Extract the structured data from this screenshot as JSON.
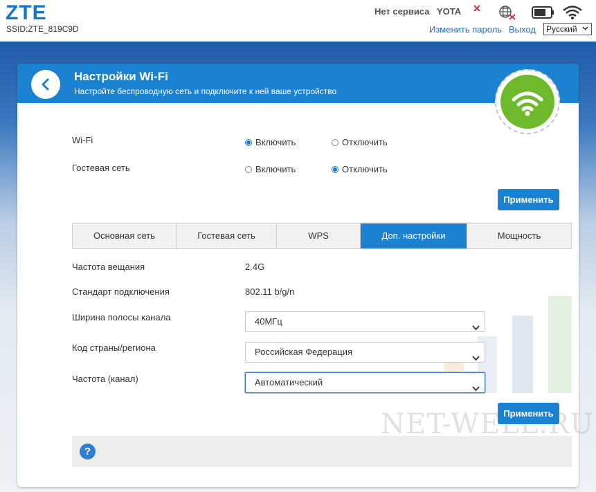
{
  "header": {
    "logo": "ZTE",
    "ssid": "SSID:ZTE_819C9D",
    "service_status": "Нет сервиса",
    "operator": "YOTA",
    "change_password": "Изменить пароль",
    "logout": "Выход",
    "language": "Русский",
    "icons": [
      "close-icon",
      "globe-disconnected-icon",
      "battery-icon",
      "wifi-signal-icon"
    ]
  },
  "panel": {
    "title": "Настройки Wi-Fi",
    "subtitle": "Настройте беспроводную сеть и подключите к ней ваше устройство",
    "wifi_row": {
      "label": "Wi-Fi",
      "on": "Включить",
      "off": "Отключить",
      "selected": "on"
    },
    "guest_row": {
      "label": "Гостевая сеть",
      "on": "Включить",
      "off": "Отключить",
      "selected": "off"
    },
    "apply_label": "Применить",
    "tabs": [
      {
        "label": "Основная сеть",
        "active": false
      },
      {
        "label": "Гостевая сеть",
        "active": false
      },
      {
        "label": "WPS",
        "active": false
      },
      {
        "label": "Доп. настройки",
        "active": true
      },
      {
        "label": "Мощность",
        "active": false
      }
    ],
    "fields": {
      "band_label": "Частота вещания",
      "band_value": "2.4G",
      "standard_label": "Стандарт подключения",
      "standard_value": "802.11 b/g/n",
      "bandwidth_label": "Ширина полосы канала",
      "bandwidth_value": "40МГц",
      "country_label": "Код страны/региона",
      "country_value": "Российская Федерация",
      "channel_label": "Частота (канал)",
      "channel_value": "Автоматический"
    },
    "apply_label_2": "Применить",
    "help_icon": "?"
  },
  "watermark": "NET-WELL.RU",
  "colors": {
    "accent": "#1a82d0",
    "wifi_green": "#6fba2c",
    "background_band": "#1f5ba8"
  }
}
